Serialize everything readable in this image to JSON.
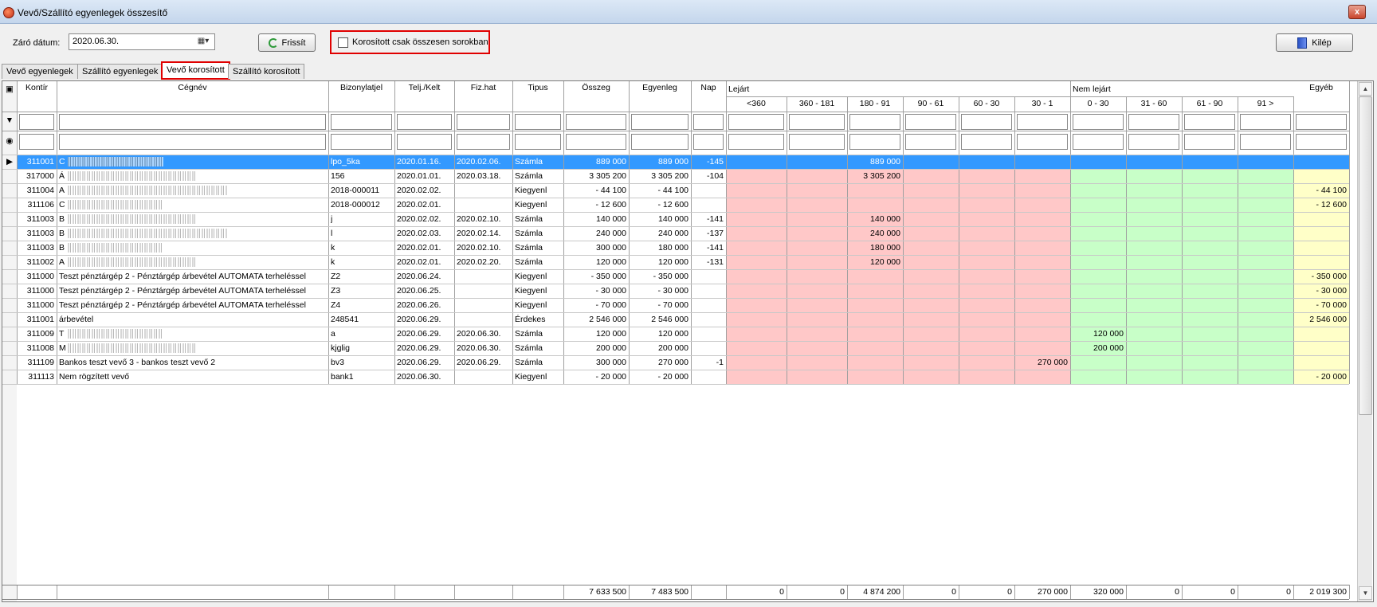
{
  "window": {
    "title": "Vevő/Szállító egyenlegek összesítő",
    "close_label": "x"
  },
  "toolbar": {
    "date_label": "Záró dátum:",
    "date_value": "2020.06.30.",
    "refresh_label": "Frissít",
    "checkbox_label": "Korosított csak összesen sorokban",
    "exit_label": "Kilép"
  },
  "tabs": [
    {
      "label": "Vevő egyenlegek"
    },
    {
      "label": "Szállító egyenlegek"
    },
    {
      "label": "Vevő korosított",
      "active": true
    },
    {
      "label": "Szállító korosított"
    }
  ],
  "grid": {
    "columns": [
      "Kontír",
      "Cégnév",
      "Bizonylatjel",
      "Telj./Kelt",
      "Fiz.hat",
      "Tipus",
      "Összeg",
      "Egyenleg",
      "Nap",
      "<360",
      "360 - 181",
      "180 - 91",
      "90 - 61",
      "60 - 30",
      "30 - 1",
      "0 - 30",
      "31 - 60",
      "61 - 90",
      "91 >",
      "Egyéb"
    ],
    "group_headers": {
      "overdue": "Lejárt",
      "not_due": "Nem lejárt",
      "other": "Egyéb"
    },
    "rows": [
      [
        "311001",
        "C",
        "lpo_5ka",
        "2020.01.16.",
        "2020.02.06.",
        "Számla",
        "889 000",
        "889 000",
        "-145",
        "",
        "",
        "889 000",
        "",
        "",
        "",
        "",
        "",
        "",
        "",
        ""
      ],
      [
        "317000",
        "Á",
        "156",
        "2020.01.01.",
        "2020.03.18.",
        "Számla",
        "3 305 200",
        "3 305 200",
        "-104",
        "",
        "",
        "3 305 200",
        "",
        "",
        "",
        "",
        "",
        "",
        "",
        ""
      ],
      [
        "311004",
        "A",
        "2018-000011",
        "2020.02.02.",
        "",
        "Kiegyenl",
        "- 44 100",
        "- 44 100",
        "",
        "",
        "",
        "",
        "",
        "",
        "",
        "",
        "",
        "",
        "",
        "- 44 100"
      ],
      [
        "311106",
        "C",
        "2018-000012",
        "2020.02.01.",
        "",
        "Kiegyenl",
        "- 12 600",
        "- 12 600",
        "",
        "",
        "",
        "",
        "",
        "",
        "",
        "",
        "",
        "",
        "",
        "- 12 600"
      ],
      [
        "311003",
        "B",
        "j",
        "2020.02.02.",
        "2020.02.10.",
        "Számla",
        "140 000",
        "140 000",
        "-141",
        "",
        "",
        "140 000",
        "",
        "",
        "",
        "",
        "",
        "",
        "",
        ""
      ],
      [
        "311003",
        "B",
        "l",
        "2020.02.03.",
        "2020.02.14.",
        "Számla",
        "240 000",
        "240 000",
        "-137",
        "",
        "",
        "240 000",
        "",
        "",
        "",
        "",
        "",
        "",
        "",
        ""
      ],
      [
        "311003",
        "B",
        "k",
        "2020.02.01.",
        "2020.02.10.",
        "Számla",
        "300 000",
        "180 000",
        "-141",
        "",
        "",
        "180 000",
        "",
        "",
        "",
        "",
        "",
        "",
        "",
        ""
      ],
      [
        "311002",
        "A",
        "k",
        "2020.02.01.",
        "2020.02.20.",
        "Számla",
        "120 000",
        "120 000",
        "-131",
        "",
        "",
        "120 000",
        "",
        "",
        "",
        "",
        "",
        "",
        "",
        ""
      ],
      [
        "311000",
        "Teszt pénztárgép 2 - Pénztárgép árbevétel AUTOMATA terheléssel",
        "Z2",
        "2020.06.24.",
        "",
        "Kiegyenl",
        "- 350 000",
        "- 350 000",
        "",
        "",
        "",
        "",
        "",
        "",
        "",
        "",
        "",
        "",
        "",
        "- 350 000"
      ],
      [
        "311000",
        "Teszt pénztárgép 2 - Pénztárgép árbevétel AUTOMATA terheléssel",
        "Z3",
        "2020.06.25.",
        "",
        "Kiegyenl",
        "- 30 000",
        "- 30 000",
        "",
        "",
        "",
        "",
        "",
        "",
        "",
        "",
        "",
        "",
        "",
        "- 30 000"
      ],
      [
        "311000",
        "Teszt pénztárgép 2 - Pénztárgép árbevétel AUTOMATA terheléssel",
        "Z4",
        "2020.06.26.",
        "",
        "Kiegyenl",
        "- 70 000",
        "- 70 000",
        "",
        "",
        "",
        "",
        "",
        "",
        "",
        "",
        "",
        "",
        "",
        "- 70 000"
      ],
      [
        "311001",
        "árbevétel",
        "248541",
        "2020.06.29.",
        "",
        "Érdekes",
        "2 546 000",
        "2 546 000",
        "",
        "",
        "",
        "",
        "",
        "",
        "",
        "",
        "",
        "",
        "",
        "2 546 000"
      ],
      [
        "311009",
        "T",
        "a",
        "2020.06.29.",
        "2020.06.30.",
        "Számla",
        "120 000",
        "120 000",
        "",
        "",
        "",
        "",
        "",
        "",
        "",
        "120 000",
        "",
        "",
        "",
        ""
      ],
      [
        "311008",
        "M",
        "kjglig",
        "2020.06.29.",
        "2020.06.30.",
        "Számla",
        "200 000",
        "200 000",
        "",
        "",
        "",
        "",
        "",
        "",
        "",
        "200 000",
        "",
        "",
        "",
        ""
      ],
      [
        "311109",
        "Bankos teszt vevő 3 - bankos teszt vevő 2",
        "bv3",
        "2020.06.29.",
        "2020.06.29.",
        "Számla",
        "300 000",
        "270 000",
        "-1",
        "",
        "",
        "",
        "",
        "",
        "270 000",
        "",
        "",
        "",
        "",
        ""
      ],
      [
        "311113",
        "Nem rögzített vevő",
        "bank1",
        "2020.06.30.",
        "",
        "Kiegyenl",
        "- 20 000",
        "- 20 000",
        "",
        "",
        "",
        "",
        "",
        "",
        "",
        "",
        "",
        "",
        "",
        "- 20 000"
      ]
    ],
    "totals": [
      "",
      "",
      "",
      "",
      "",
      "",
      "7 633 500",
      "7 483 500",
      "",
      "0",
      "0",
      "4 874 200",
      "0",
      "0",
      "270 000",
      "320 000",
      "0",
      "0",
      "0",
      "2 019 300"
    ]
  },
  "colors": {
    "selected": "#3399ff",
    "overdue": "#ffc8c8",
    "not_due": "#c8ffc8",
    "other": "#ffffc8"
  }
}
